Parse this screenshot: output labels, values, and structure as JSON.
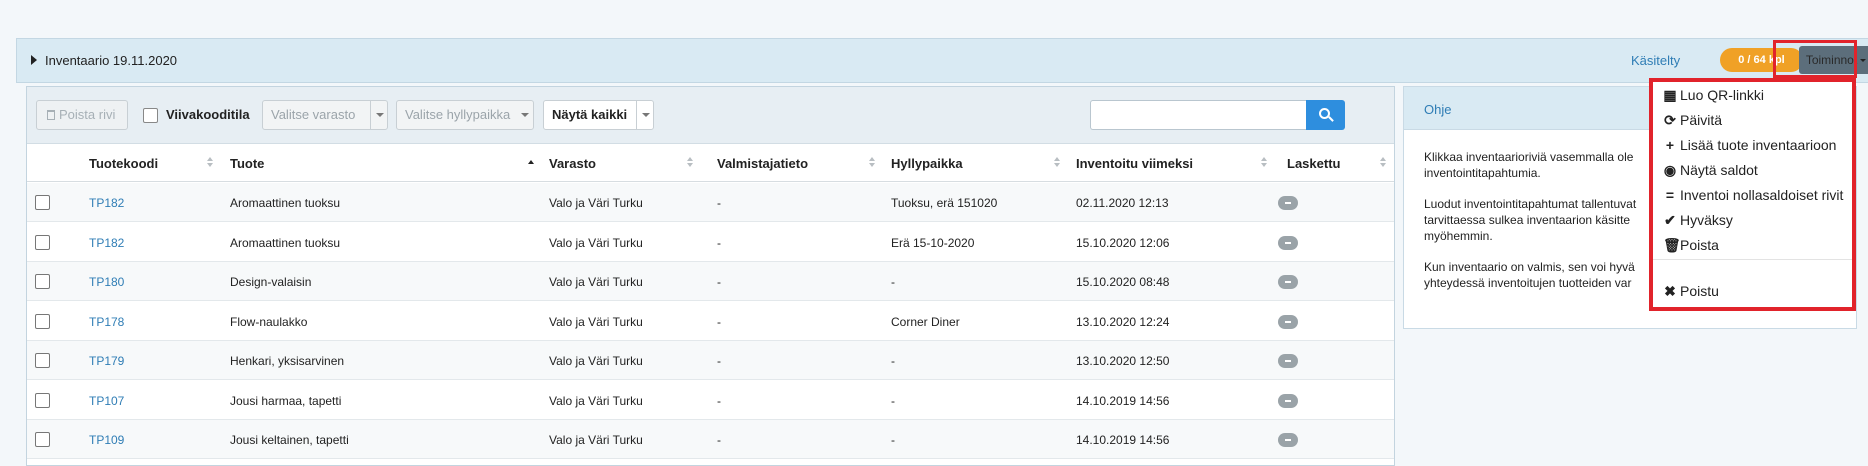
{
  "header": {
    "title": "Inventaario 19.11.2020",
    "status_label": "Käsitelty",
    "status_badge": "0 / 64 kpl",
    "actions_label": "Toiminnot"
  },
  "toolbar": {
    "delete_label": "Poista rivi",
    "barcode_label": "Viivakooditila",
    "warehouse_placeholder": "Valitse varasto",
    "shelf_placeholder": "Valitse hyllypaikka",
    "show_label": "Näytä kaikki",
    "search_value": ""
  },
  "table": {
    "columns": [
      "Tuotekoodi",
      "Tuote",
      "Varasto",
      "Valmistajatieto",
      "Hyllypaikka",
      "Inventoitu viimeksi",
      "Laskettu"
    ],
    "rows": [
      {
        "code": "TP182",
        "product": "Aromaattinen tuoksu",
        "warehouse": "Valo ja Väri Turku",
        "maker": "-",
        "shelf": "Tuoksu, erä 151020",
        "last": "02.11.2020 12:13"
      },
      {
        "code": "TP182",
        "product": "Aromaattinen tuoksu",
        "warehouse": "Valo ja Väri Turku",
        "maker": "-",
        "shelf": "Erä 15-10-2020",
        "last": "15.10.2020 12:06"
      },
      {
        "code": "TP180",
        "product": "Design-valaisin",
        "warehouse": "Valo ja Väri Turku",
        "maker": "-",
        "shelf": "-",
        "last": "15.10.2020 08:48"
      },
      {
        "code": "TP178",
        "product": "Flow-naulakko",
        "warehouse": "Valo ja Väri Turku",
        "maker": "-",
        "shelf": "Corner Diner",
        "last": "13.10.2020 12:24"
      },
      {
        "code": "TP179",
        "product": "Henkari, yksisarvinen",
        "warehouse": "Valo ja Väri Turku",
        "maker": "-",
        "shelf": "-",
        "last": "13.10.2020 12:50"
      },
      {
        "code": "TP107",
        "product": "Jousi harmaa, tapetti",
        "warehouse": "Valo ja Väri Turku",
        "maker": "-",
        "shelf": "-",
        "last": "14.10.2019 14:56"
      },
      {
        "code": "TP109",
        "product": "Jousi keltainen, tapetti",
        "warehouse": "Valo ja Väri Turku",
        "maker": "-",
        "shelf": "-",
        "last": "14.10.2019 14:56"
      }
    ]
  },
  "help": {
    "title": "Ohje",
    "p1": [
      "Klikkaa inventaarioriviä vasemmalla ole",
      "inventointitapahtumia."
    ],
    "p2": [
      "Luodut inventointitapahtumat tallentuvat",
      "tarvittaessa sulkea inventaarion käsitte",
      "myöhemmin."
    ],
    "p3": [
      "Kun inventaario on valmis, sen voi hyvä",
      "yhteydessä inventoitujen tuotteiden var"
    ]
  },
  "menu": {
    "items": [
      {
        "icon": "qr-icon",
        "glyph": "▦",
        "label": "Luo QR-linkki"
      },
      {
        "icon": "refresh-icon",
        "glyph": "⟳",
        "label": "Päivitä"
      },
      {
        "icon": "plus-icon",
        "glyph": "+",
        "label": "Lisää tuote inventaarioon"
      },
      {
        "icon": "eye-icon",
        "glyph": "◉",
        "label": "Näytä saldot"
      },
      {
        "icon": "equals-icon",
        "glyph": "=",
        "label": "Inventoi nollasaldoiset rivit"
      },
      {
        "icon": "check-icon",
        "glyph": "✔",
        "label": "Hyväksy"
      },
      {
        "icon": "trash-icon",
        "glyph": "🗑",
        "label": "Poista"
      }
    ],
    "exit": {
      "icon": "close-icon",
      "glyph": "✖",
      "label": "Poistu"
    }
  },
  "colors": {
    "accent": "#2f7db5",
    "badge": "#f0a126",
    "highlight": "#e1232b",
    "search_button": "#2e8ede"
  }
}
